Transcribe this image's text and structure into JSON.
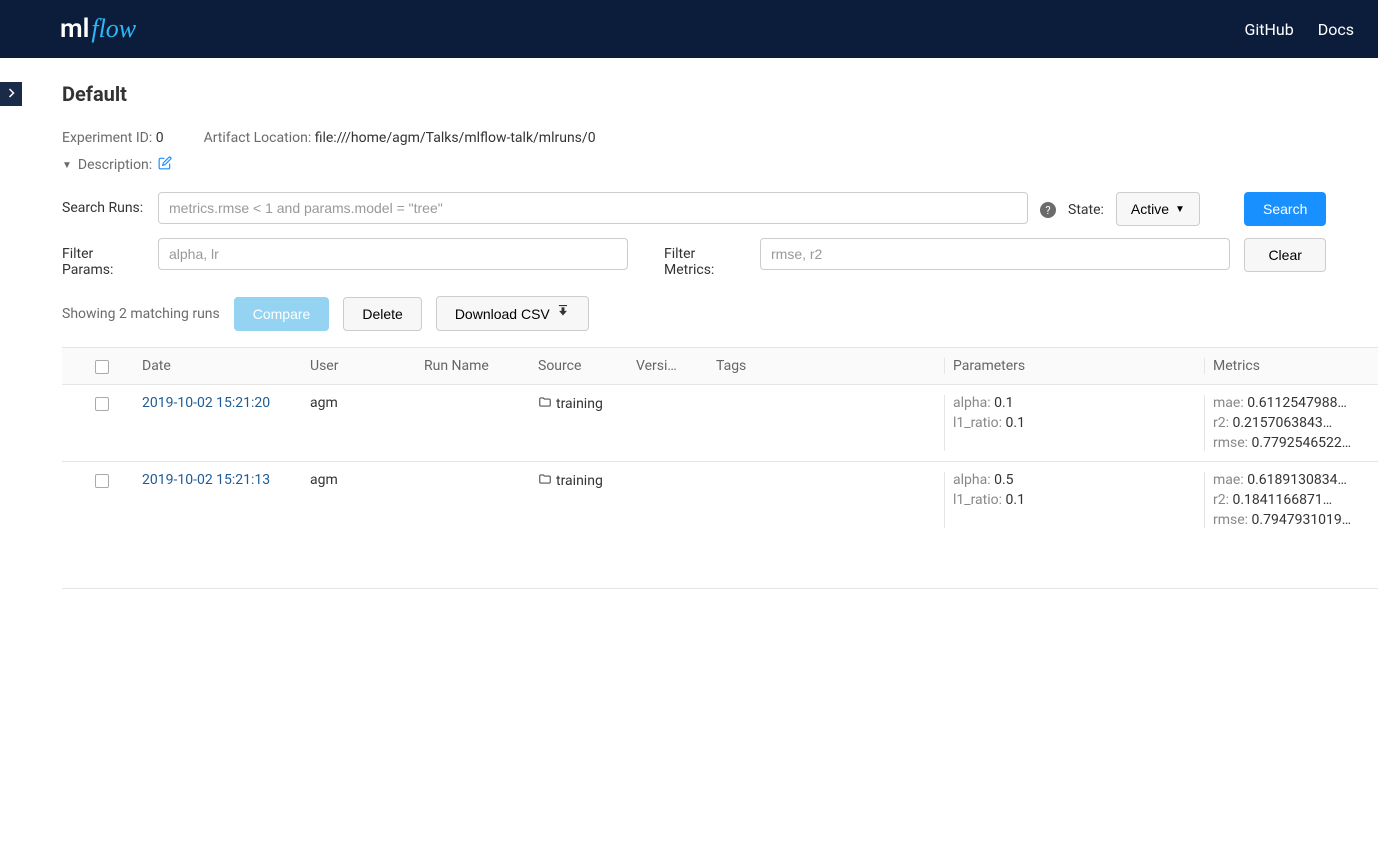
{
  "header": {
    "logo_ml": "ml",
    "logo_flow": "flow",
    "nav": {
      "github": "GitHub",
      "docs": "Docs"
    }
  },
  "page": {
    "title": "Default",
    "experiment_id_label": "Experiment ID:",
    "experiment_id": "0",
    "artifact_location_label": "Artifact Location:",
    "artifact_location": "file:///home/agm/Talks/mlflow-talk/mlruns/0",
    "description_label": "Description:"
  },
  "search": {
    "search_runs_label": "Search Runs:",
    "search_placeholder": "metrics.rmse < 1 and params.model = \"tree\"",
    "state_label": "State:",
    "state_value": "Active",
    "search_button": "Search",
    "clear_button": "Clear",
    "filter_params_label": "Filter Params:",
    "filter_params_placeholder": "alpha, lr",
    "filter_metrics_label": "Filter Metrics:",
    "filter_metrics_placeholder": "rmse, r2"
  },
  "actions": {
    "summary": "Showing 2 matching runs",
    "compare": "Compare",
    "delete": "Delete",
    "download": "Download CSV"
  },
  "table": {
    "headers": {
      "date": "Date",
      "user": "User",
      "run_name": "Run Name",
      "source": "Source",
      "version": "Versi…",
      "tags": "Tags",
      "parameters": "Parameters",
      "metrics": "Metrics"
    },
    "rows": [
      {
        "date": "2019-10-02 15:21:20",
        "user": "agm",
        "source": "training",
        "params": [
          {
            "k": "alpha:",
            "v": "0.1"
          },
          {
            "k": "l1_ratio:",
            "v": "0.1"
          }
        ],
        "metrics": [
          {
            "k": "mae:",
            "v": "0.6112547988…"
          },
          {
            "k": "r2:",
            "v": "0.2157063843…"
          },
          {
            "k": "rmse:",
            "v": "0.7792546522…"
          }
        ]
      },
      {
        "date": "2019-10-02 15:21:13",
        "user": "agm",
        "source": "training",
        "params": [
          {
            "k": "alpha:",
            "v": "0.5"
          },
          {
            "k": "l1_ratio:",
            "v": "0.1"
          }
        ],
        "metrics": [
          {
            "k": "mae:",
            "v": "0.6189130834…"
          },
          {
            "k": "r2:",
            "v": "0.1841166871…"
          },
          {
            "k": "rmse:",
            "v": "0.7947931019…"
          }
        ]
      }
    ]
  }
}
